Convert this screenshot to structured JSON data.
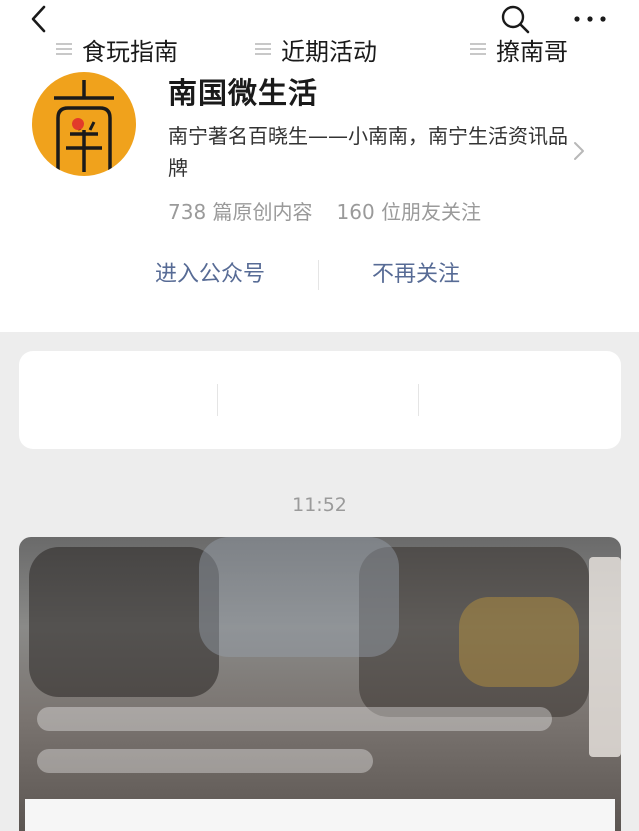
{
  "nav": {
    "back_icon": "chevron-left-icon",
    "search_icon": "search-icon",
    "more_icon": "more-horizontal-icon"
  },
  "account": {
    "logo_icon": "brand-logo",
    "name": "南国微生活",
    "description": "南宁著名百晓生——小南南，南宁生活资讯品牌",
    "articles": "738 篇原创内容",
    "friends": "160 位朋友关注",
    "arrow_icon": "chevron-right-icon"
  },
  "actions": {
    "enter": "进入公众号",
    "unfollow": "不再关注"
  },
  "menu": [
    {
      "label": "食玩指南",
      "icon": "menu-lines-icon"
    },
    {
      "label": "近期活动",
      "icon": "menu-lines-icon"
    },
    {
      "label": "撩南哥",
      "icon": "menu-lines-icon"
    }
  ],
  "feed": {
    "time": "11:52"
  },
  "colors": {
    "link": "#576b95",
    "logo_bg": "#f0a21c",
    "logo_dot": "#e23b2a"
  }
}
